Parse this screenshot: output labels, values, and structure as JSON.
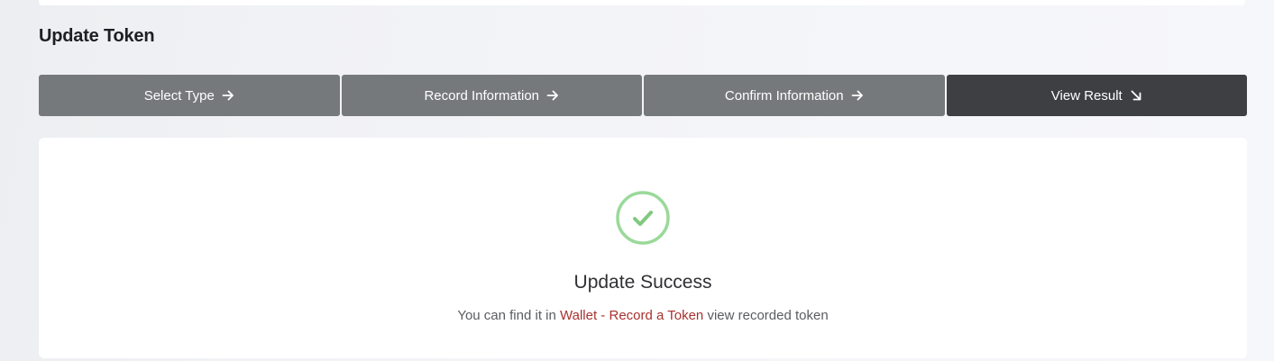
{
  "page": {
    "title": "Update Token"
  },
  "steps": [
    {
      "label": "Select Type",
      "icon": "arrow-right-icon",
      "state": "completed"
    },
    {
      "label": "Record Information",
      "icon": "arrow-right-icon",
      "state": "completed"
    },
    {
      "label": "Confirm Information",
      "icon": "arrow-right-icon",
      "state": "completed"
    },
    {
      "label": "View Result",
      "icon": "arrow-down-right-icon",
      "state": "active"
    }
  ],
  "result": {
    "icon": "check-circle-icon",
    "title": "Update Success",
    "desc_prefix": "You can find it in ",
    "link_wallet": "Wallet",
    "separator": " - ",
    "link_record": "Record a Token",
    "desc_suffix": " view recorded token"
  },
  "colors": {
    "step_inactive": "#76797c",
    "step_active": "#3e3f43",
    "success_green": "#9ad99a",
    "link_red": "#a8322e"
  }
}
